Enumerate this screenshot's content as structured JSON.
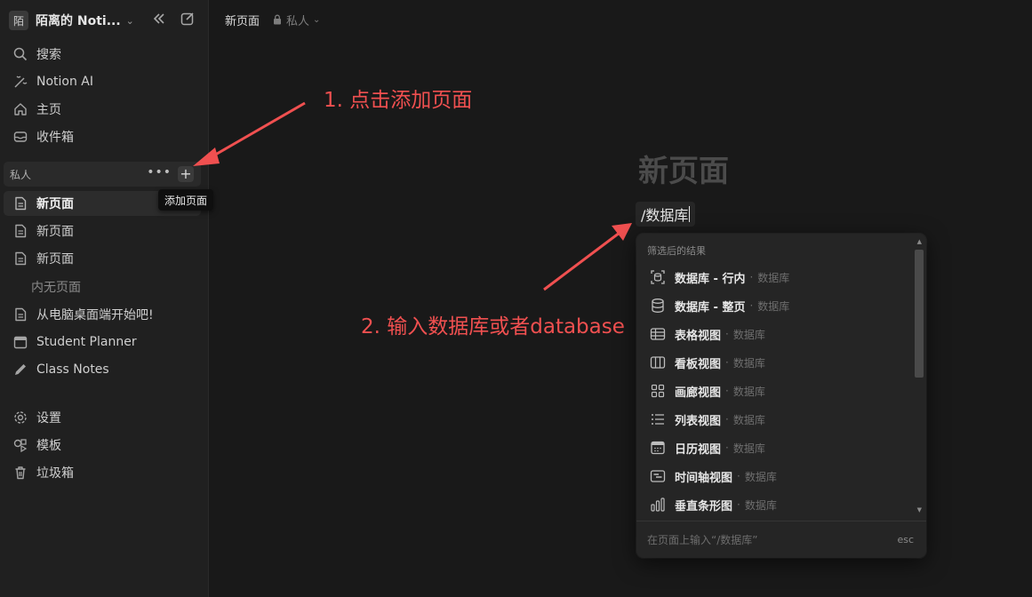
{
  "workspace": {
    "avatar": "陌",
    "name": "陌离的 Noti..."
  },
  "sidebar": {
    "top_items": [
      {
        "icon": "search-icon",
        "label": "搜索"
      },
      {
        "icon": "notion-ai-icon",
        "label": "Notion AI"
      },
      {
        "icon": "home-icon",
        "label": "主页"
      },
      {
        "icon": "inbox-icon",
        "label": "收件箱"
      }
    ],
    "section_label": "私人",
    "pages": [
      {
        "icon": "page-icon",
        "label": "新页面",
        "active": true
      },
      {
        "icon": "page-icon",
        "label": "新页面"
      },
      {
        "icon": "page-icon",
        "label": "新页面"
      }
    ],
    "empty_label": "内无页面",
    "more_pages": [
      {
        "icon": "page-icon",
        "label": "从电脑桌面端开始吧!"
      },
      {
        "icon": "calendar-icon",
        "label": "Student Planner"
      },
      {
        "icon": "pencil-icon",
        "label": "Class Notes"
      }
    ],
    "bottom_items": [
      {
        "icon": "settings-icon",
        "label": "设置"
      },
      {
        "icon": "templates-icon",
        "label": "模板"
      },
      {
        "icon": "trash-icon",
        "label": "垃圾箱"
      }
    ],
    "tooltip": "添加页面"
  },
  "topbar": {
    "breadcrumb": "新页面",
    "privacy": "私人"
  },
  "editor": {
    "page_title": "新页面",
    "command_text": "/数据库"
  },
  "annotations": {
    "step1": "1. 点击添加页面",
    "step2": "2. 输入数据库或者database",
    "color": "#f05050"
  },
  "dropdown": {
    "header": "筛选后的结果",
    "separator": "·",
    "items": [
      {
        "icon": "database-inline-icon",
        "name": "数据库 - 行内",
        "category": "数据库"
      },
      {
        "icon": "database-full-icon",
        "name": "数据库 - 整页",
        "category": "数据库"
      },
      {
        "icon": "table-view-icon",
        "name": "表格视图",
        "category": "数据库"
      },
      {
        "icon": "board-view-icon",
        "name": "看板视图",
        "category": "数据库"
      },
      {
        "icon": "gallery-view-icon",
        "name": "画廊视图",
        "category": "数据库"
      },
      {
        "icon": "list-view-icon",
        "name": "列表视图",
        "category": "数据库"
      },
      {
        "icon": "calendar-view-icon",
        "name": "日历视图",
        "category": "数据库"
      },
      {
        "icon": "timeline-view-icon",
        "name": "时间轴视图",
        "category": "数据库"
      },
      {
        "icon": "bar-chart-icon",
        "name": "垂直条形图",
        "category": "数据库"
      }
    ],
    "footer": "在页面上输入“/数据库”",
    "esc": "esc"
  }
}
